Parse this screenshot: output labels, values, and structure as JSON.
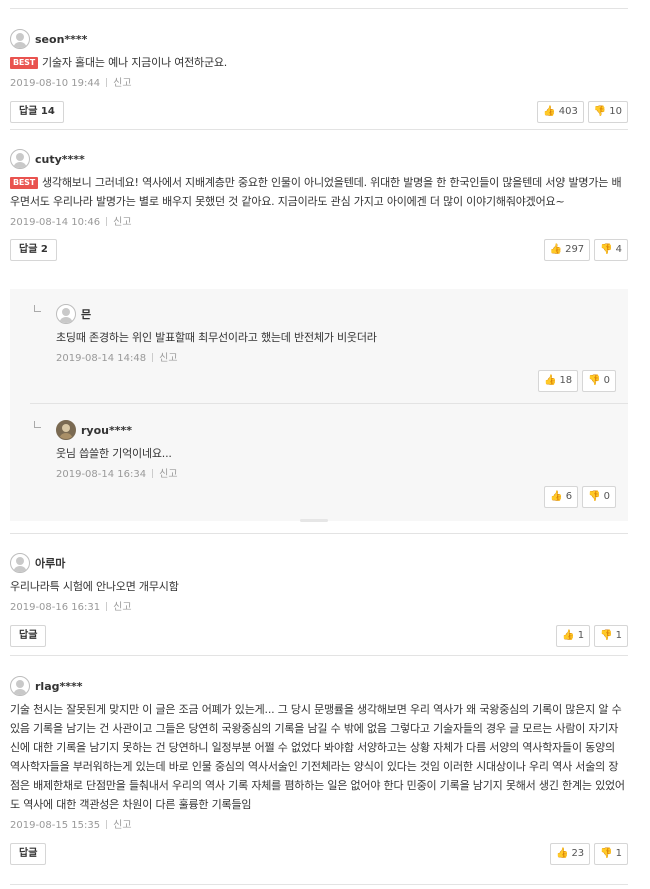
{
  "comments": [
    {
      "author": "seon****",
      "best": true,
      "best_label": "BEST",
      "text": "기술자 홀대는 예나 지금이나 여전하군요.",
      "date": "2019-08-10 19:44",
      "report": "신고",
      "reply_label": "답글 14",
      "likes": "403",
      "dislikes": "10"
    },
    {
      "author": "cuty****",
      "best": true,
      "best_label": "BEST",
      "text": "생각해보니 그러네요! 역사에서 지배계층만 중요한 인물이 아니었을텐데. 위대한 발명을 한 한국인들이 많을텐데 서양 발명가는 배우면서도 우리나라 발명가는 별로 배우지 못했던 것 같아요. 지금이라도 관심 가지고 아이에겐 더 많이 이야기해줘야겠어요~",
      "date": "2019-08-14 10:46",
      "report": "신고",
      "reply_label": "답글 2",
      "likes": "297",
      "dislikes": "4",
      "replies": [
        {
          "author": "믄",
          "text": "초딩때 존경하는 위인 발표할때 최무선이라고 했는데 반전체가 비웃더라",
          "date": "2019-08-14 14:48",
          "report": "신고",
          "likes": "18",
          "dislikes": "0"
        },
        {
          "author": "ryou****",
          "text": "웃님 씁쓸한 기억이네요...",
          "date": "2019-08-14 16:34",
          "report": "신고",
          "likes": "6",
          "dislikes": "0"
        }
      ]
    },
    {
      "author": "아루마",
      "text": "우리나라특 시험에 안나오면 개무시함",
      "date": "2019-08-16 16:31",
      "report": "신고",
      "reply_label": "답글",
      "likes": "1",
      "dislikes": "1"
    },
    {
      "author": "rlag****",
      "text": "기술 천시는 잘못된게 맞지만 이 글은 조금 어폐가 있는게... 그 당시 문맹률을 생각해보면 우리 역사가 왜 국왕중심의 기록이 많은지 알 수 있음 기록을 남기는 건 사관이고 그들은 당연히 국왕중심의 기록을 남길 수 밖에 없음 그렇다고 기술자들의 경우 글 모르는 사람이 자기자신에 대한 기록을 남기지 못하는 건 당연하니 일정부분 어쩔 수 없었다 봐야함 서양하고는 상황 자체가 다름 서양의 역사학자들이 동양의 역사학자들을 부러워하는게 있는데 바로 인물 중심의 역사서술인 기전체라는 양식이 있다는 것임 이러한 시대상이나 우리 역사 서술의 장점은 배제한채로 단점만을 들춰내서 우리의 역사 기록 자체를 폄하하는 일은 없어야 한다 민중이 기록을 남기지 못해서 생긴 한계는 있었어도 역사에 대한 객관성은 차원이 다른 훌륭한 기록들임",
      "date": "2019-08-15 15:35",
      "report": "신고",
      "reply_label": "답글",
      "likes": "23",
      "dislikes": "1"
    }
  ],
  "icons": {
    "like": "thumbs-up-icon",
    "dislike": "thumbs-down-icon",
    "avatar": "user-avatar-icon"
  },
  "colors": {
    "best_badge": "#e9534f",
    "thumb": "#e08a46",
    "reply_bg": "#f7f7f7"
  }
}
